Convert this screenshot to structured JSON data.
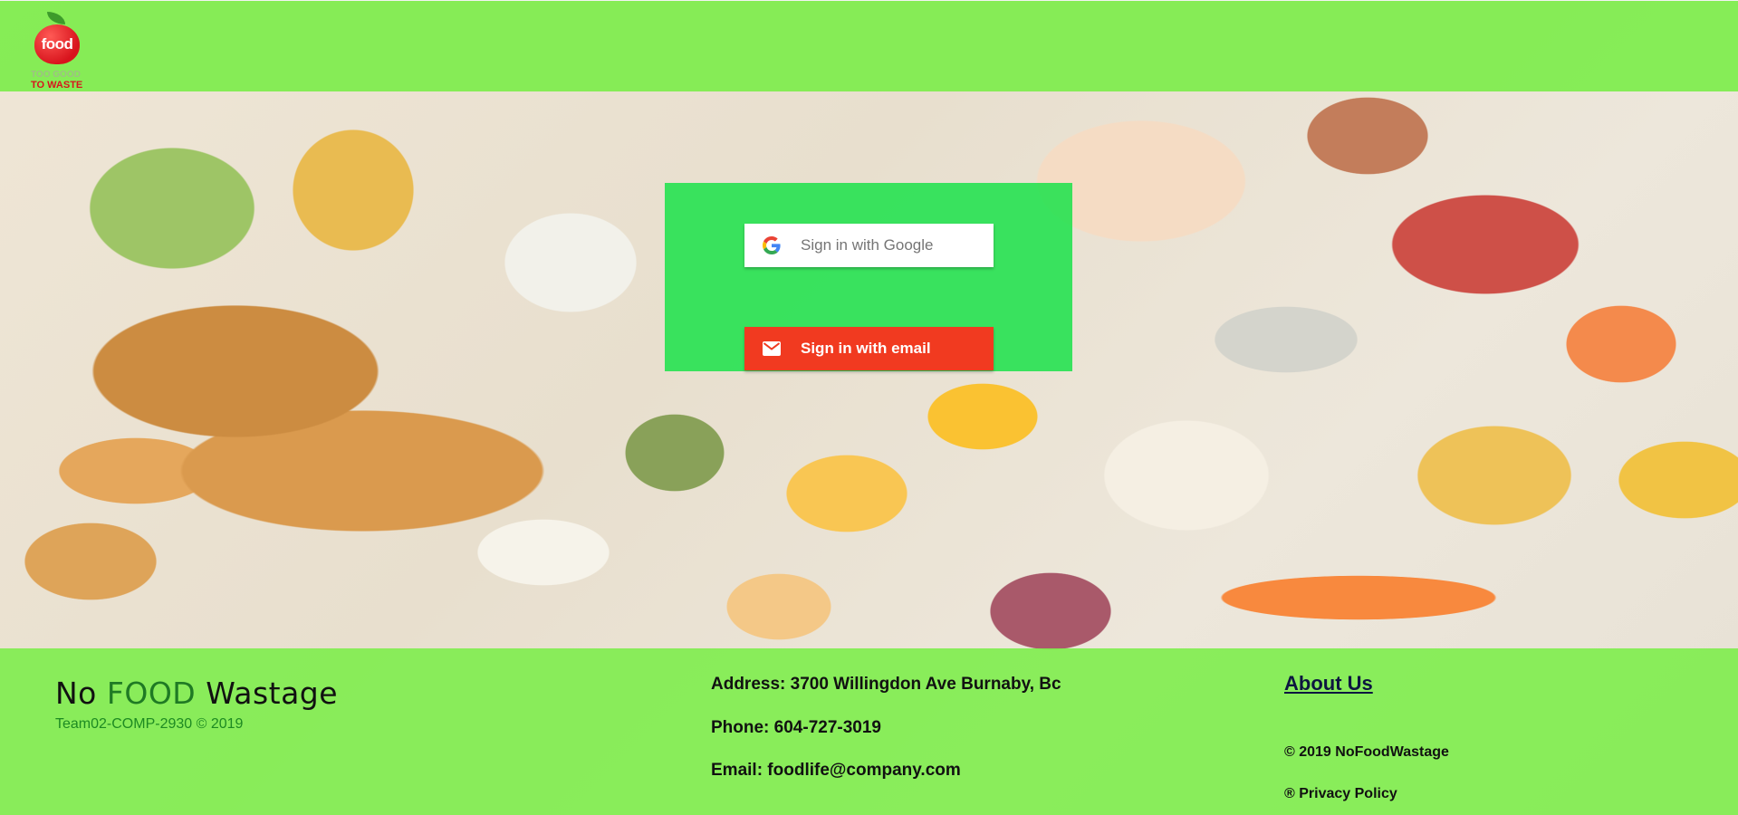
{
  "header": {
    "logo": {
      "word": "food",
      "line1": "TOO GOOD",
      "line2": "TO WASTE"
    }
  },
  "signin": {
    "google_label": "Sign in with Google",
    "email_label": "Sign in with email",
    "google_icon": "google-g-icon",
    "email_icon": "envelope-icon"
  },
  "footer": {
    "brand_prefix": "No ",
    "brand_highlight": "FOOD",
    "brand_suffix": " Wastage",
    "team": "Team02-COMP-2930 © 2019",
    "address": "Address: 3700 Willingdon Ave Burnaby, Bc",
    "phone": "Phone: 604-727-3019",
    "email": "Email: foodlife@company.com",
    "about_link": "About Us",
    "copyright": "© 2019 NoFoodWastage",
    "privacy": "® Privacy Policy"
  },
  "colors": {
    "bar_green": "#7eed4c",
    "panel_green": "#1ce24b",
    "email_red": "#f13a20",
    "brand_highlight": "#1f7a24"
  }
}
